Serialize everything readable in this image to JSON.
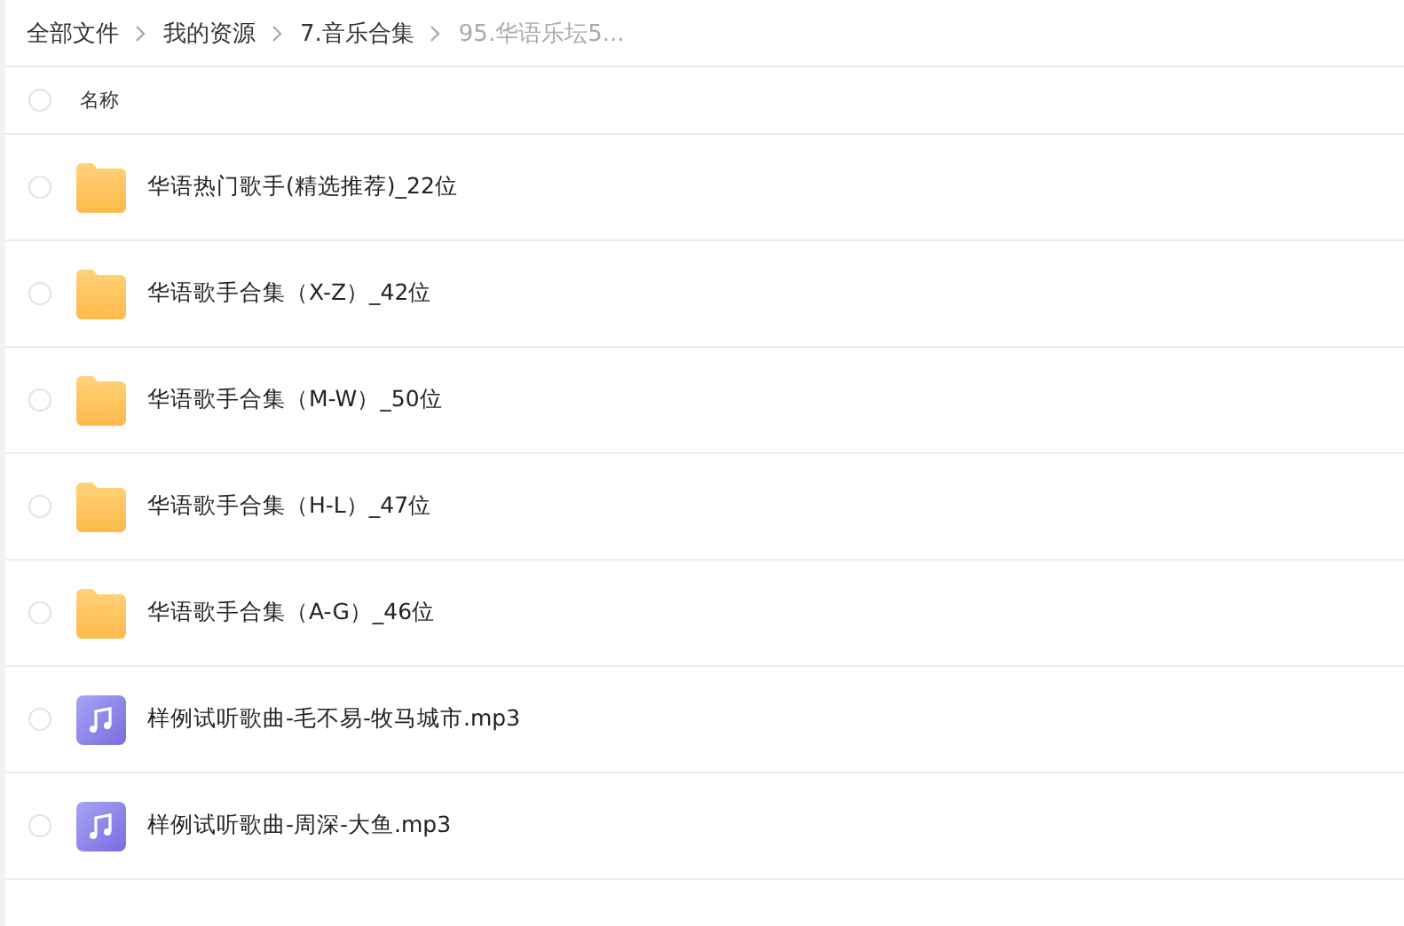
{
  "breadcrumb": [
    {
      "label": "全部文件",
      "current": false
    },
    {
      "label": "我的资源",
      "current": false
    },
    {
      "label": "7.音乐合集",
      "current": false
    },
    {
      "label": "95.华语乐坛5...",
      "current": true
    }
  ],
  "header": {
    "label": "名称",
    "selected": false
  },
  "rows": [
    {
      "kind": "folder",
      "name": "华语热门歌手(精选推荐)_22位",
      "selected": false
    },
    {
      "kind": "folder",
      "name": "华语歌手合集（X-Z）_42位",
      "selected": false
    },
    {
      "kind": "folder",
      "name": "华语歌手合集（M-W）_50位",
      "selected": false
    },
    {
      "kind": "folder",
      "name": "华语歌手合集（H-L）_47位",
      "selected": false
    },
    {
      "kind": "folder",
      "name": "华语歌手合集（A-G）_46位",
      "selected": false
    },
    {
      "kind": "audio",
      "name": "样例试听歌曲-毛不易-牧马城市.mp3",
      "selected": false
    },
    {
      "kind": "audio",
      "name": "样例试听歌曲-周深-大鱼.mp3",
      "selected": false
    }
  ]
}
